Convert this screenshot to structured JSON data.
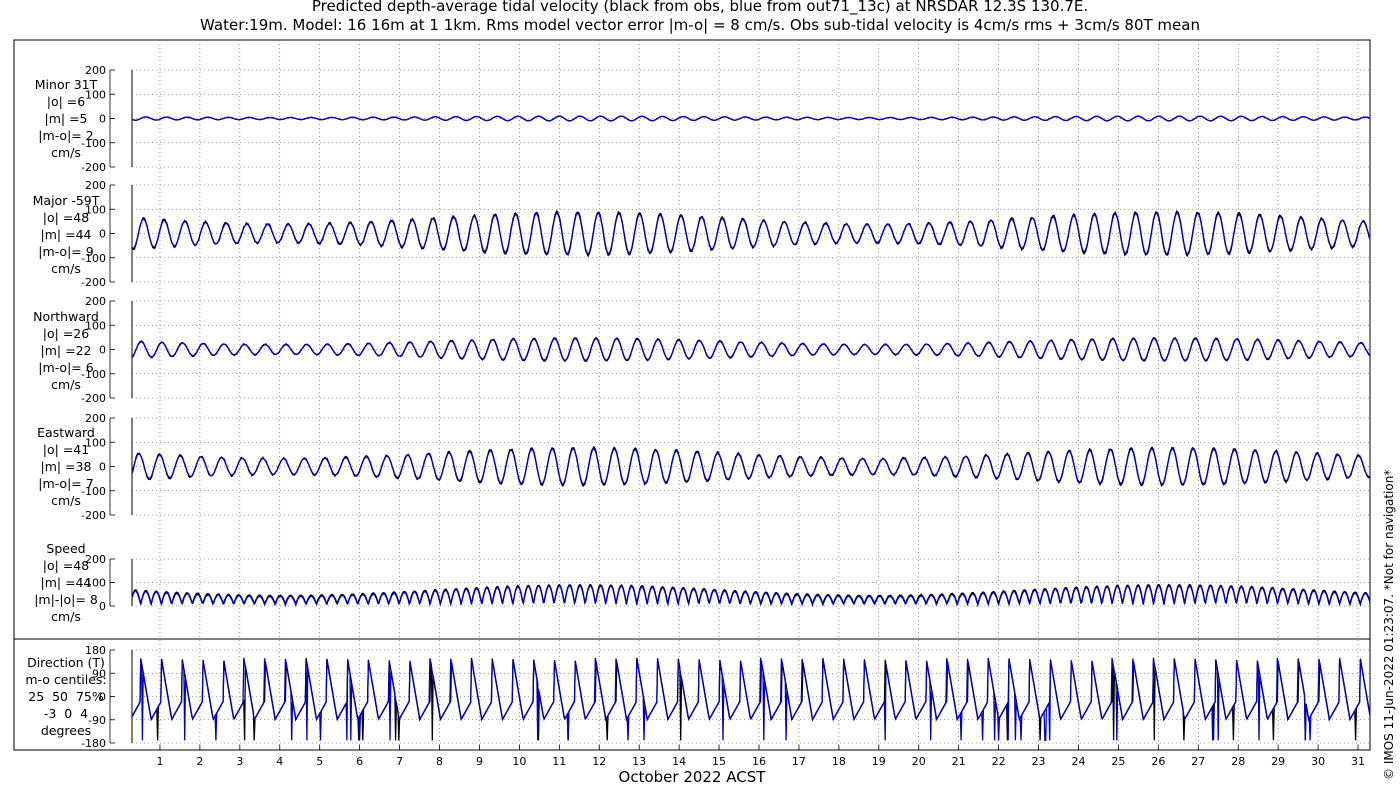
{
  "title_line1": "Predicted depth-average tidal velocity (black from obs, blue from out71_13c) at NRSDAR 12.3S 130.7E.",
  "title_line2": "Water:19m. Model: 16 16m at 1 1km. Rms model vector error |m-o| = 8 cm/s. Obs sub-tidal velocity is 4cm/s rms + 3cm/s 80T mean",
  "credit": "© IMOS 11-Jun-2022 01:23:07. *Not for navigation*",
  "colors": {
    "obs": "#000000",
    "model": "#0000cc",
    "grid": "#555555"
  },
  "chart_data": {
    "type": "line",
    "xlabel": "October 2022 ACST",
    "xlim": [
      0.3,
      31.3
    ],
    "x_ticks": [
      1,
      2,
      3,
      4,
      5,
      6,
      7,
      8,
      9,
      10,
      11,
      12,
      13,
      14,
      15,
      16,
      17,
      18,
      19,
      20,
      21,
      22,
      23,
      24,
      25,
      26,
      27,
      28,
      29,
      30,
      31
    ],
    "series_names": [
      "obs",
      "model"
    ],
    "panels": [
      {
        "id": "minor",
        "label": [
          "Minor 31T",
          "|o| =6",
          "|m| =5",
          "|m-o|= 2",
          "cm/s"
        ],
        "ylim": [
          -200,
          200
        ],
        "yticks": [
          200,
          100,
          0,
          -100,
          -200
        ],
        "ytick_labels": [
          "200",
          "100",
          "0",
          "-100",
          "-200"
        ],
        "amplitude": 10,
        "rms": {
          "obs": 6,
          "model": 5,
          "diff": 2
        }
      },
      {
        "id": "major",
        "label": [
          "Major -59T",
          "|o| =48",
          "|m| =44",
          "|m-o|= 9",
          "cm/s"
        ],
        "ylim": [
          -200,
          200
        ],
        "yticks": [
          200,
          100,
          0,
          -100,
          -200
        ],
        "ytick_labels": [
          "200",
          "100",
          "0",
          "-100",
          "-200"
        ],
        "amplitude": 90,
        "rms": {
          "obs": 48,
          "model": 44,
          "diff": 9
        }
      },
      {
        "id": "northward",
        "label": [
          "Northward",
          "|o| =26",
          "|m| =22",
          "|m-o|= 6",
          "cm/s"
        ],
        "ylim": [
          -200,
          200
        ],
        "yticks": [
          200,
          100,
          0,
          -100,
          -200
        ],
        "ytick_labels": [
          "200",
          "100",
          "0",
          "-100",
          "-200"
        ],
        "amplitude": 48,
        "rms": {
          "obs": 26,
          "model": 22,
          "diff": 6
        }
      },
      {
        "id": "eastward",
        "label": [
          "Eastward",
          "|o| =41",
          "|m| =38",
          "|m-o|= 7",
          "cm/s"
        ],
        "ylim": [
          -200,
          200
        ],
        "yticks": [
          200,
          100,
          0,
          -100,
          -200
        ],
        "ytick_labels": [
          "200",
          "100",
          "0",
          "-100",
          "-200"
        ],
        "amplitude": 78,
        "rms": {
          "obs": 41,
          "model": 38,
          "diff": 7
        }
      },
      {
        "id": "speed",
        "label": [
          "Speed",
          "|o| =48",
          "|m| =44",
          "|m|-|o|= 8",
          "cm/s"
        ],
        "ylim": [
          0,
          200
        ],
        "yticks": [
          200,
          100,
          0
        ],
        "ytick_labels": [
          "200",
          "100",
          "0"
        ],
        "amplitude": 90,
        "rms": {
          "obs": 48,
          "model": 44,
          "diff": 8
        }
      },
      {
        "id": "direction",
        "label": [
          "Direction (T)",
          "m-o centiles:",
          "25  50  75%",
          "-3  0  4",
          "degrees"
        ],
        "ylim": [
          -180,
          180
        ],
        "yticks": [
          180,
          90,
          0,
          -90,
          -180
        ],
        "ytick_labels": [
          "180",
          "90",
          "0",
          "-90",
          "-180"
        ],
        "centiles": {
          "p25": -3,
          "p50": 0,
          "p75": 4
        }
      }
    ]
  }
}
